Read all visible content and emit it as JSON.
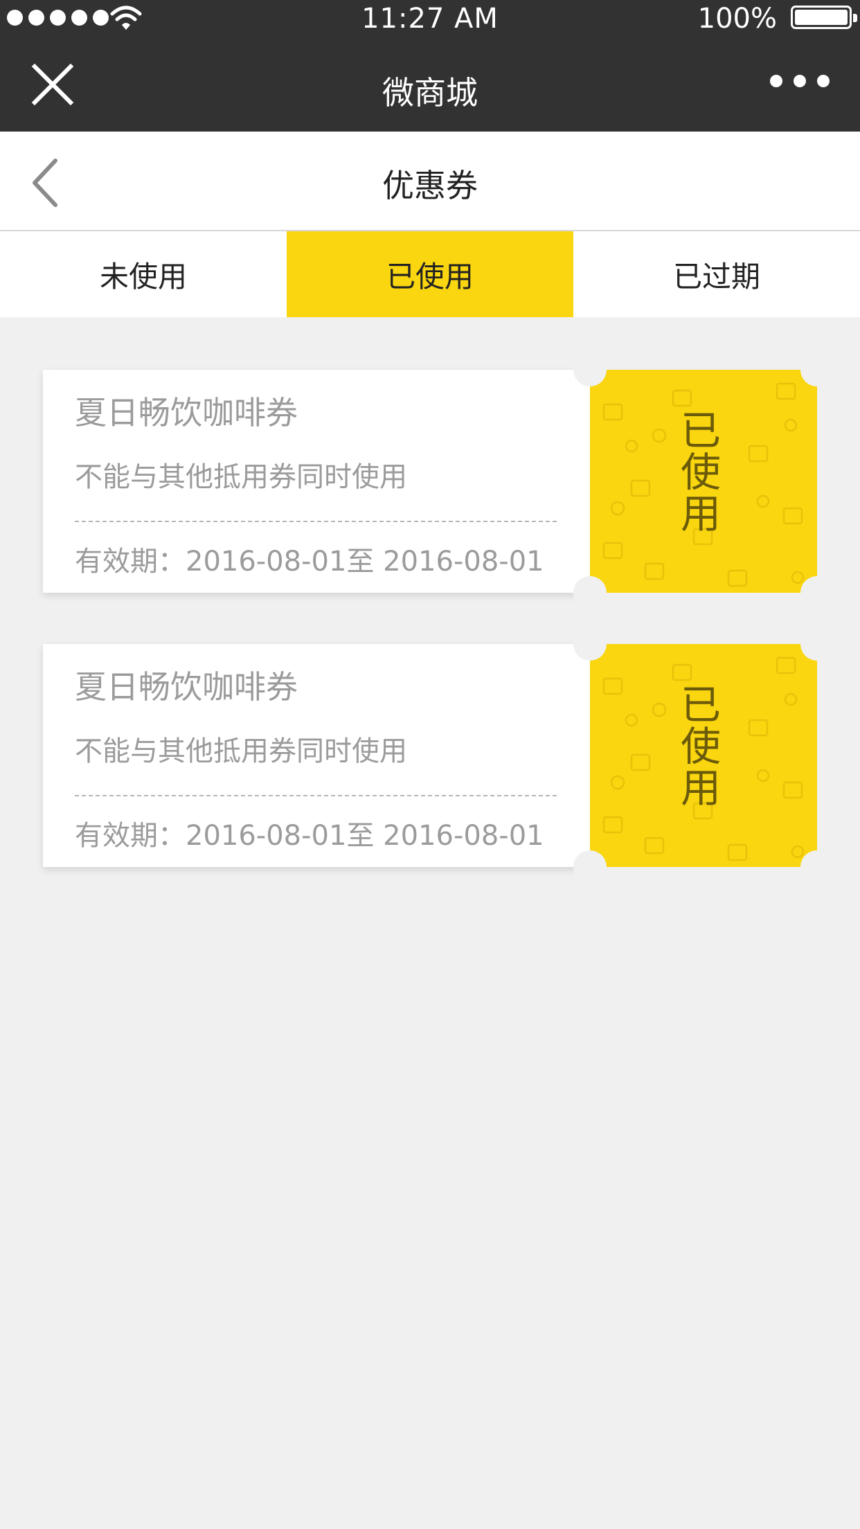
{
  "status_bar": {
    "time": "11:27 AM",
    "battery": "100%",
    "battery_level": 1.0
  },
  "navbar": {
    "title": "微商城",
    "close_icon": "close-icon",
    "more_icon": "more-icon"
  },
  "header": {
    "title": "优惠券",
    "back_icon": "chevron-left-icon"
  },
  "tabs": [
    {
      "label": "未使用",
      "active": false
    },
    {
      "label": "已使用",
      "active": true
    },
    {
      "label": "已过期",
      "active": false
    }
  ],
  "coupons": [
    {
      "name": "夏日畅饮咖啡券",
      "description": "不能与其他抵用券同时使用",
      "validity": "有效期：2016-08-01至 2016-08-01",
      "status": "已使用"
    },
    {
      "name": "夏日畅饮咖啡券",
      "description": "不能与其他抵用券同时使用",
      "validity": "有效期：2016-08-01至 2016-08-01",
      "status": "已使用"
    }
  ],
  "colors": {
    "accent": "#f9d60f",
    "dark_bar": "#323232",
    "background": "#f0f0f0",
    "muted_text": "#9b9b9b"
  }
}
